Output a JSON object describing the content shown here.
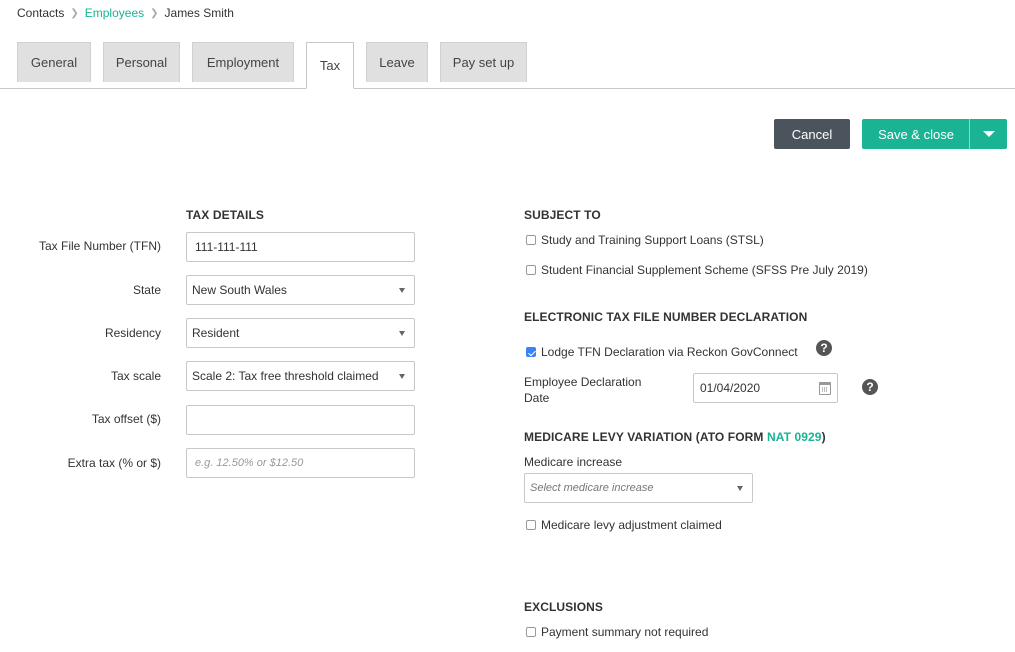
{
  "breadcrumb": {
    "root": "Contacts",
    "section": "Employees",
    "current": "James Smith"
  },
  "tabs": [
    {
      "label": "General"
    },
    {
      "label": "Personal"
    },
    {
      "label": "Employment"
    },
    {
      "label": "Tax"
    },
    {
      "label": "Leave"
    },
    {
      "label": "Pay set up"
    }
  ],
  "active_tab": "Tax",
  "actions": {
    "cancel": "Cancel",
    "save": "Save & close"
  },
  "tax_details": {
    "title": "TAX DETAILS",
    "tfn_label": "Tax File Number (TFN)",
    "tfn_value": "111-111-111",
    "state_label": "State",
    "state_value": "New South Wales",
    "residency_label": "Residency",
    "residency_value": "Resident",
    "scale_label": "Tax scale",
    "scale_value": "Scale 2: Tax free threshold claimed",
    "offset_label": "Tax offset ($)",
    "offset_value": "",
    "extra_label": "Extra tax (% or $)",
    "extra_placeholder": "e.g. 12.50% or $12.50"
  },
  "subject_to": {
    "title": "SUBJECT TO",
    "stsl": {
      "label": "Study and Training Support Loans (STSL)",
      "checked": false
    },
    "sfss": {
      "label": "Student Financial Supplement Scheme (SFSS Pre July 2019)",
      "checked": false
    }
  },
  "etfn": {
    "title": "ELECTRONIC TAX FILE NUMBER DECLARATION",
    "lodge": {
      "label": "Lodge TFN Declaration via Reckon GovConnect",
      "checked": true
    },
    "date_label_line1": "Employee Declaration",
    "date_label_line2": "Date",
    "date_value": "01/04/2020",
    "help": "?"
  },
  "medicare": {
    "title": "MEDICARE LEVY VARIATION (ATO FORM ",
    "title_link": "NAT 0929",
    "title_end": ")",
    "increase_label": "Medicare increase",
    "increase_placeholder": "Select medicare increase",
    "adjustment": {
      "label": "Medicare levy adjustment claimed",
      "checked": false
    }
  },
  "exclusions": {
    "title": "EXCLUSIONS",
    "summary": {
      "label": "Payment summary not required",
      "checked": false
    }
  }
}
